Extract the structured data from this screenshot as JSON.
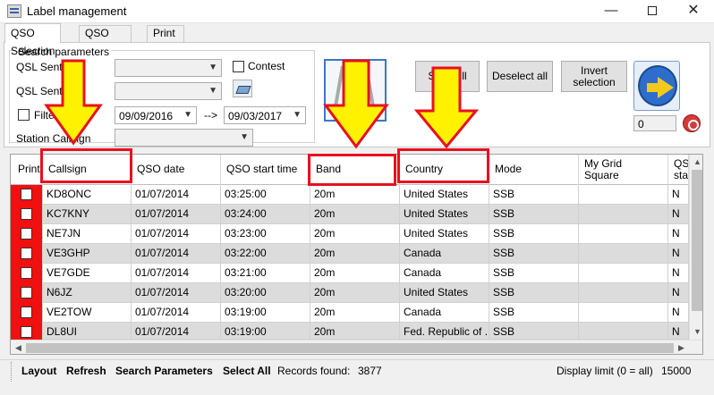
{
  "window": {
    "title": "Label management"
  },
  "tabs": [
    {
      "label": "QSO Selection"
    },
    {
      "label": "QSO Analysis"
    },
    {
      "label": "Print"
    }
  ],
  "search": {
    "group_label": "Search parameters",
    "qsl_sent_label_1": "QSL Sent",
    "qsl_sent_label_2": "QSL Sent",
    "contest_label": "Contest",
    "filter_label": "Filter d",
    "date_from": "09/09/2016",
    "date_sep": "-->",
    "date_to": "09/03/2017",
    "station_callsign_label": "Station Callsign"
  },
  "buttons": {
    "select_all_partial": "S",
    "select_all_tail": "ll",
    "deselect_all": "Deselect all",
    "invert_line1": "Invert",
    "invert_line2": "selection",
    "counter_value": "0"
  },
  "grid": {
    "columns": [
      {
        "label": "Print"
      },
      {
        "label": "Callsign"
      },
      {
        "label": "QSO date"
      },
      {
        "label": "QSO start time"
      },
      {
        "label": "Band"
      },
      {
        "label": "Country"
      },
      {
        "label": "Mode"
      },
      {
        "label": "My Grid Square"
      },
      {
        "label": "QSL stat"
      }
    ],
    "rows": [
      {
        "callsign": "KD8ONC",
        "date": "01/07/2014",
        "time": "03:25:00",
        "band": "20m",
        "country": "United States",
        "mode": "SSB",
        "grid": "",
        "qsl": "N"
      },
      {
        "callsign": "KC7KNY",
        "date": "01/07/2014",
        "time": "03:24:00",
        "band": "20m",
        "country": "United States",
        "mode": "SSB",
        "grid": "",
        "qsl": "N"
      },
      {
        "callsign": "NE7JN",
        "date": "01/07/2014",
        "time": "03:23:00",
        "band": "20m",
        "country": "United States",
        "mode": "SSB",
        "grid": "",
        "qsl": "N"
      },
      {
        "callsign": "VE3GHP",
        "date": "01/07/2014",
        "time": "03:22:00",
        "band": "20m",
        "country": "Canada",
        "mode": "SSB",
        "grid": "",
        "qsl": "N"
      },
      {
        "callsign": "VE7GDE",
        "date": "01/07/2014",
        "time": "03:21:00",
        "band": "20m",
        "country": "Canada",
        "mode": "SSB",
        "grid": "",
        "qsl": "N"
      },
      {
        "callsign": "N6JZ",
        "date": "01/07/2014",
        "time": "03:20:00",
        "band": "20m",
        "country": "United States",
        "mode": "SSB",
        "grid": "",
        "qsl": "N"
      },
      {
        "callsign": "VE2TOW",
        "date": "01/07/2014",
        "time": "03:19:00",
        "band": "20m",
        "country": "Canada",
        "mode": "SSB",
        "grid": "",
        "qsl": "N"
      },
      {
        "callsign": "DL8UI",
        "date": "01/07/2014",
        "time": "03:19:00",
        "band": "20m",
        "country": "Fed. Republic of ...",
        "mode": "SSB",
        "grid": "",
        "qsl": "N"
      }
    ]
  },
  "statusbar": {
    "layout": "Layout",
    "refresh": "Refresh",
    "search_parameters": "Search Parameters",
    "select_all": "Select All",
    "records_label": "Records found:",
    "records_value": "3877",
    "display_limit_label": "Display limit (0 = all)",
    "display_limit_value": "15000"
  },
  "colors": {
    "print_cell": "#f01010",
    "highlight": "#e8101e",
    "arrow_fill": "#fff200",
    "alt_row": "#dcdcdc"
  }
}
